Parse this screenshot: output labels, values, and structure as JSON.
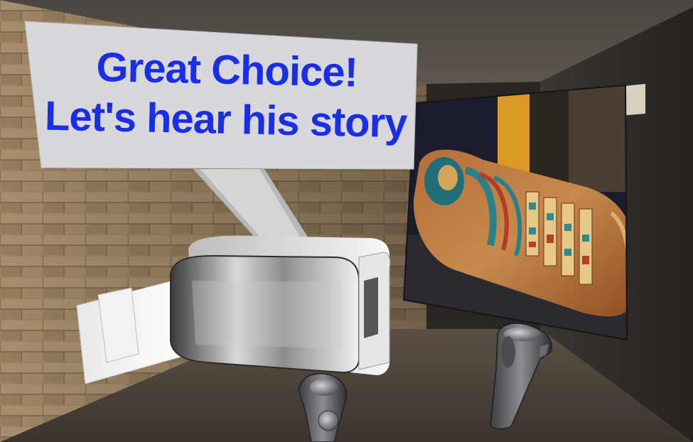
{
  "sign": {
    "line1": "Great Choice!",
    "line2": "Let's hear his story",
    "text_color": "#1a2ee8",
    "panel_color": "#d8d8dc"
  },
  "scene": {
    "setting": "stone-walled tomb corridor",
    "objects": [
      "vr-headset",
      "vr-controller-left",
      "vr-controller-right",
      "mummy-sarcophagus-picture"
    ]
  }
}
